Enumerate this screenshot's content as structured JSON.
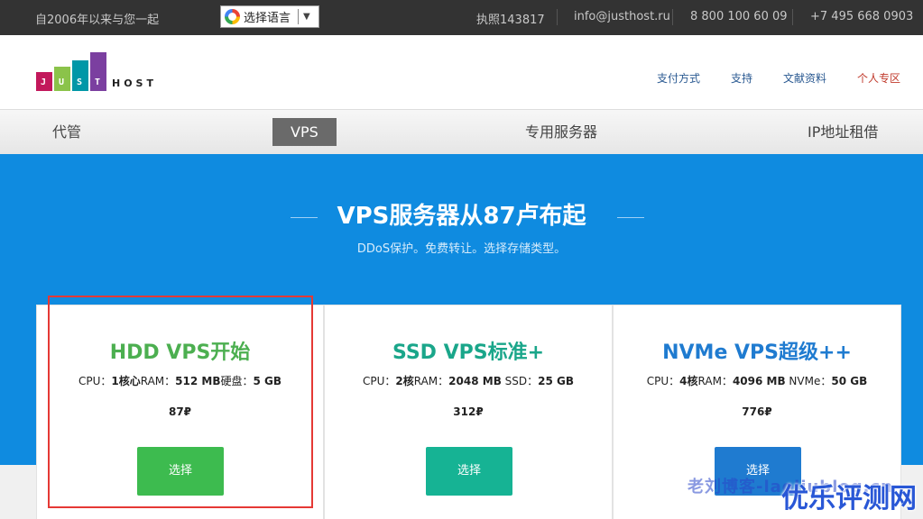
{
  "topbar": {
    "since": "自2006年以来与您一起",
    "translate_label": "选择语言",
    "license": "执照143817",
    "email": "info@justhost.ru",
    "phone1": "8 800 100 60 09",
    "phone2": "+7 495 668 0903"
  },
  "logo": {
    "letters": [
      "J",
      "U",
      "S",
      "T"
    ],
    "host": "HOST",
    "colors": [
      "#c2185b",
      "#8bc34a",
      "#0097a7",
      "#7b3fa0"
    ]
  },
  "nav": {
    "payment": "支付方式",
    "support": "支持",
    "docs": "文献资料",
    "account": "个人专区"
  },
  "tabs": [
    "代管",
    "VPS",
    "专用服务器",
    "IP地址租借"
  ],
  "hero": {
    "title": "VPS服务器从87卢布起",
    "subtitle": "DDoS保护。免费转让。选择存储类型。"
  },
  "plans": [
    {
      "title": "HDD VPS开始",
      "color": "#4caf50",
      "cpu_label": "CPU：",
      "cpu": "1核心",
      "ram_label": "RAM：",
      "ram": "512 MB",
      "disk_label": "硬盘：",
      "disk": "5 GB",
      "price": "87₽",
      "button": "选择",
      "button_color": "#3dbb4f"
    },
    {
      "title": "SSD VPS标准+",
      "color": "#1aa68a",
      "cpu_label": "CPU：",
      "cpu": "2核",
      "ram_label": "RAM：",
      "ram": "2048 MB",
      "disk_label": " SSD：",
      "disk": "25 GB",
      "price": "312₽",
      "button": "选择",
      "button_color": "#16b394"
    },
    {
      "title": "NVMe VPS超级++",
      "color": "#1f7bd0",
      "cpu_label": "CPU：",
      "cpu": "4核",
      "ram_label": "RAM：",
      "ram": "4096 MB",
      "disk_label": " NVMe：",
      "disk": "50 GB",
      "price": "776₽",
      "button": "选择",
      "button_color": "#1f7bd0"
    }
  ],
  "watermark": {
    "text1": "老刘博客-laoliublog.cn",
    "text2": "优乐评测网"
  }
}
